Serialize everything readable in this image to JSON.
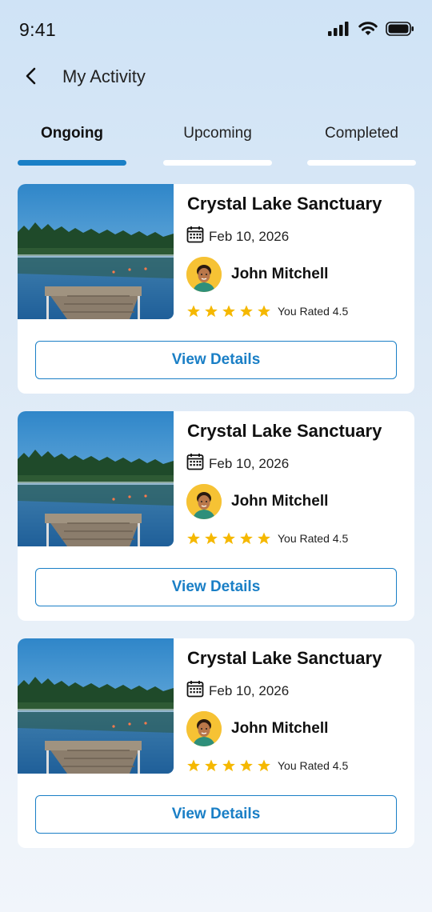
{
  "status_bar": {
    "time": "9:41"
  },
  "header": {
    "title": "My Activity"
  },
  "tabs": [
    {
      "label": "Ongoing",
      "active": true
    },
    {
      "label": "Upcoming",
      "active": false
    },
    {
      "label": "Completed",
      "active": false
    }
  ],
  "cards": [
    {
      "title": "Crystal Lake Sanctuary",
      "date": "Feb 10, 2026",
      "host": "John Mitchell",
      "stars": 5,
      "rating_text": "You Rated 4.5",
      "button_label": "View Details"
    },
    {
      "title": "Crystal Lake Sanctuary",
      "date": "Feb 10, 2026",
      "host": "John Mitchell",
      "stars": 5,
      "rating_text": "You Rated 4.5",
      "button_label": "View Details"
    },
    {
      "title": "Crystal Lake Sanctuary",
      "date": "Feb 10, 2026",
      "host": "John Mitchell",
      "stars": 5,
      "rating_text": "You Rated 4.5",
      "button_label": "View Details"
    }
  ],
  "colors": {
    "accent": "#1a7fc6",
    "star": "#f5b800",
    "avatar_bg": "#f6c234"
  },
  "icons": [
    "signal-icon",
    "wifi-icon",
    "battery-icon",
    "back-arrow-icon",
    "calendar-icon",
    "star-icon"
  ]
}
